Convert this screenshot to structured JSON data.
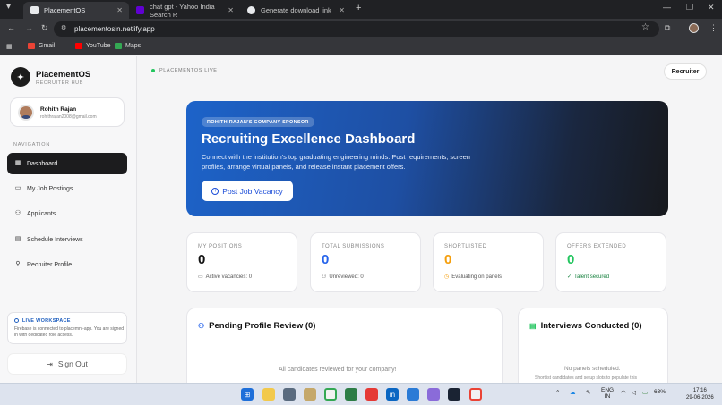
{
  "browser": {
    "tabs": [
      {
        "title": "PlacementOS",
        "active": true,
        "icon": "globe-icon"
      },
      {
        "title": "chat gpt - Yahoo India Search R",
        "active": false,
        "icon": "yahoo-icon"
      },
      {
        "title": "Generate download link",
        "active": false,
        "icon": "globe-icon"
      }
    ],
    "url": "placementosin.netlify.app",
    "bookmarks": [
      {
        "label": "Gmail",
        "icon": "gmail-icon"
      },
      {
        "label": "YouTube",
        "icon": "youtube-icon"
      },
      {
        "label": "Maps",
        "icon": "maps-icon"
      }
    ]
  },
  "sidebar": {
    "brand": "PlacementOS",
    "brand_sub": "RECRUITER HUB",
    "user": {
      "name": "Rohith Rajan",
      "email": "rohithrajan2008@gmail.com"
    },
    "nav_label": "NAVIGATION",
    "items": [
      {
        "label": "Dashboard",
        "icon": "dashboard-icon",
        "active": true
      },
      {
        "label": "My Job Postings",
        "icon": "briefcase-icon",
        "active": false
      },
      {
        "label": "Applicants",
        "icon": "users-icon",
        "active": false
      },
      {
        "label": "Schedule Interviews",
        "icon": "calendar-icon",
        "active": false
      },
      {
        "label": "Recruiter Profile",
        "icon": "user-icon",
        "active": false
      }
    ],
    "workspace": {
      "title": "LIVE WORKSPACE",
      "text": "Firebase is connected to placemnt-app. You are signed in with dedicated role access."
    },
    "signout": "Sign Out"
  },
  "header": {
    "live_label": "PLACEMENTOS LIVE",
    "role_button": "Recruiter"
  },
  "hero": {
    "badge": "ROHITH RAJAN'S COMPANY SPONSOR",
    "title": "Recruiting Excellence Dashboard",
    "description": "Connect with the institution's top graduating engineering minds. Post requirements, screen profiles, arrange virtual panels, and release instant placement offers.",
    "button": "Post Job Vacancy"
  },
  "stats": [
    {
      "label": "MY POSITIONS",
      "value": "0",
      "note": "Active vacancies: 0",
      "color": "#111111",
      "note_color": "#555555"
    },
    {
      "label": "TOTAL SUBMISSIONS",
      "value": "0",
      "note": "Unreviewed: 0",
      "color": "#2563eb",
      "note_color": "#555555"
    },
    {
      "label": "SHORTLISTED",
      "value": "0",
      "note": "Evaluating on panels",
      "color": "#f59e0b",
      "note_color": "#555555"
    },
    {
      "label": "OFFERS EXTENDED",
      "value": "0",
      "note": "Talent secured",
      "color": "#22c55e",
      "note_color": "#15803d"
    }
  ],
  "panels": {
    "pending": {
      "title": "Pending Profile Review (0)",
      "empty": "All candidates reviewed for your company!"
    },
    "interviews": {
      "title": "Interviews Conducted (0)",
      "empty": "No panels scheduled.",
      "hint": "Shortlist candidates and setup slots to populate this"
    }
  },
  "taskbar": {
    "lang": "ENG",
    "region": "IN",
    "battery": "63%",
    "time": "17:16",
    "date": "29-06-2026"
  }
}
